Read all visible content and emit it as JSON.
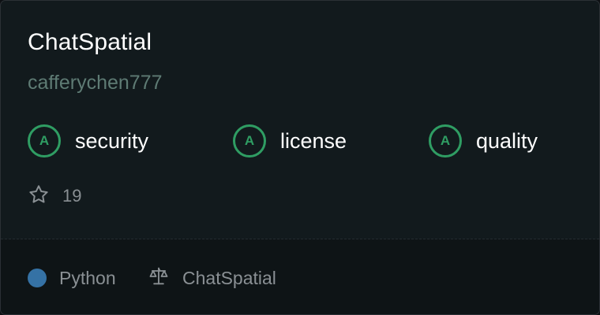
{
  "repo": {
    "name": "ChatSpatial",
    "owner": "cafferychen777"
  },
  "grades": [
    {
      "letter": "A",
      "label": "security"
    },
    {
      "letter": "A",
      "label": "license"
    },
    {
      "letter": "A",
      "label": "quality"
    }
  ],
  "stars": {
    "count": "19",
    "icon": "star-icon"
  },
  "footer": {
    "language": "Python",
    "language_color": "#3572a5",
    "license": "ChatSpatial",
    "license_icon": "scale-icon"
  },
  "colors": {
    "grade_accent": "#2f9d63",
    "owner_text": "#5e7b74",
    "card_bg": "#121a1d"
  }
}
